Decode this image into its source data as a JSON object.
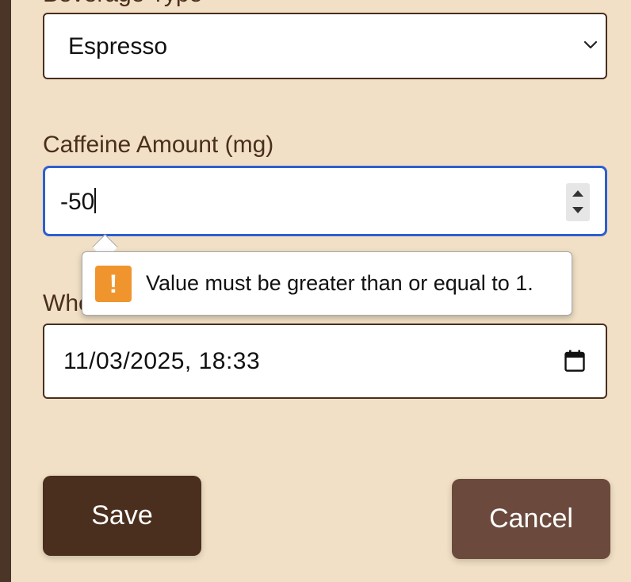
{
  "form": {
    "beverage_type": {
      "label": "Beverage Type",
      "value": "Espresso"
    },
    "caffeine_amount": {
      "label": "Caffeine Amount (mg)",
      "value": "-50"
    },
    "when": {
      "label": "When",
      "value": "11/03/2025, 18:33"
    }
  },
  "validation": {
    "message": "Value must be greater than or equal to 1.",
    "icon": "warning-icon",
    "icon_color": "#f0952e"
  },
  "buttons": {
    "save_label": "Save",
    "cancel_label": "Cancel"
  },
  "colors": {
    "background": "#f1e0c5",
    "primary": "#4a2e1e",
    "secondary": "#6b4a3d",
    "focus": "#2d5fd0"
  }
}
